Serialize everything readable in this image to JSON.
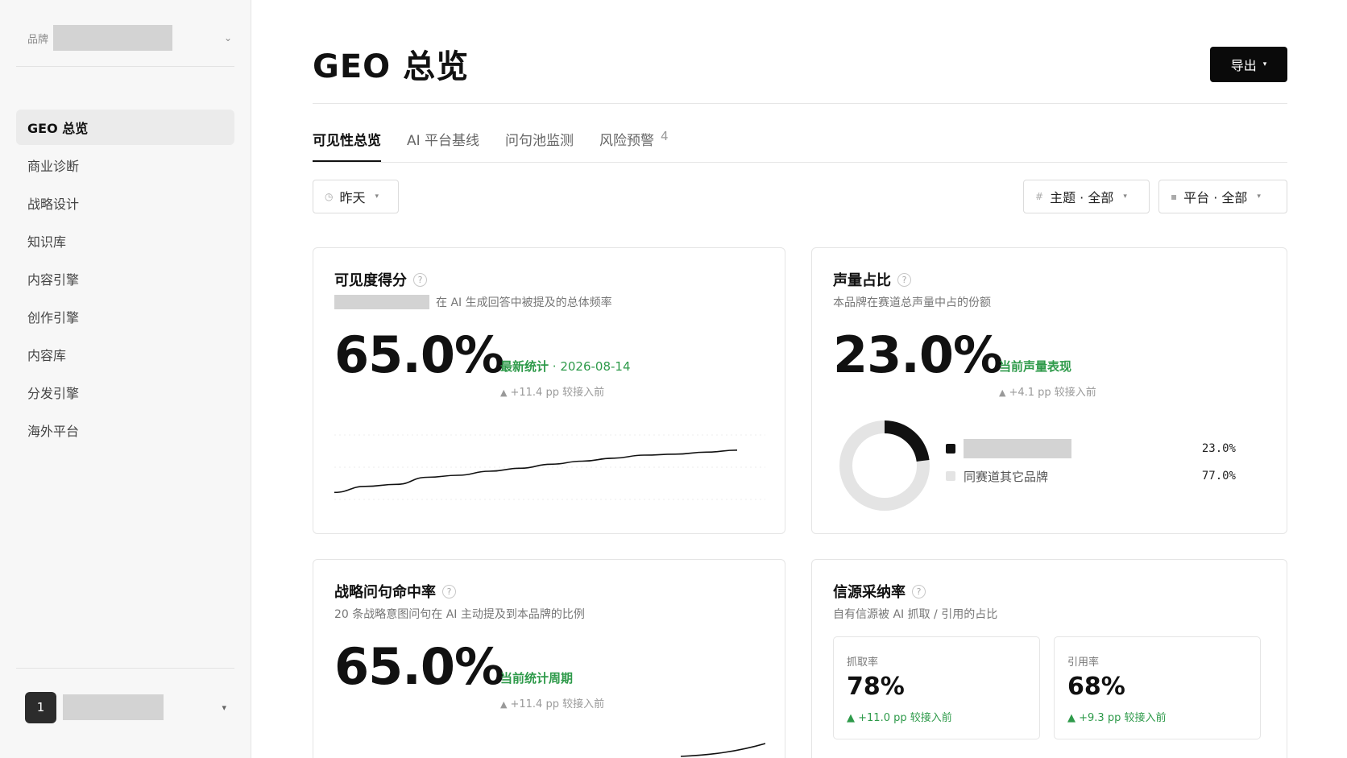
{
  "sidebar": {
    "brand_label": "品牌",
    "brand_caret": "⌄",
    "nav": [
      "GEO 总览",
      "商业诊断",
      "战略设计",
      "知识库",
      "内容引擎",
      "创作引擎",
      "内容库",
      "分发引擎",
      "海外平台"
    ],
    "user": {
      "avatar_text": "1",
      "caret": "▾"
    }
  },
  "header": {
    "title": "GEO 总览",
    "export_label": "导出",
    "export_caret": "▾"
  },
  "tabs": [
    {
      "label": "可见性总览",
      "active": true
    },
    {
      "label": "AI 平台基线"
    },
    {
      "label": "问句池监测"
    },
    {
      "label": "风险预警",
      "count": "4"
    }
  ],
  "filters": {
    "date": {
      "icon": "clock-icon",
      "label": "昨天"
    },
    "topic": {
      "icon": "hash-icon",
      "label": "主题 · 全部"
    },
    "platform": {
      "icon": "square-icon",
      "label": "平台 · 全部"
    },
    "caret": "▾"
  },
  "cards": {
    "visibility": {
      "title": "可见度得分",
      "subtitle": "在 AI 生成回答中被提及的总体频率",
      "value": "65.0%",
      "status": "最新统计",
      "date": " · 2026-08-14",
      "delta": "+11.4 pp 较接入前",
      "trend": [
        65,
        59,
        57,
        50,
        48,
        44,
        41,
        37,
        34,
        31,
        28,
        27,
        25,
        23
      ]
    },
    "share": {
      "title": "声量占比",
      "subtitle": "本品牌在赛道总声量中占的份额",
      "value": "23.0%",
      "status": "当前声量表现",
      "delta": "+4.1 pp 较接入前",
      "legend": [
        {
          "label": "",
          "value": "23.0%",
          "color": "#111111"
        },
        {
          "label": "同赛道其它品牌",
          "value": "77.0%",
          "color": "#e4e4e4"
        }
      ],
      "donut_fraction": 0.23
    },
    "strategy": {
      "title": "战略问句命中率",
      "subtitle": "20 条战略意图问句在 AI 主动提及到本品牌的比例",
      "value": "65.0%",
      "status": "当前统计周期",
      "delta": "+11.4 pp 较接入前"
    },
    "source": {
      "title": "信源采纳率",
      "subtitle": "自有信源被 AI 抓取 / 引用的占比",
      "crawl": {
        "label": "抓取率",
        "value": "78%",
        "delta": "+11.0 pp 较接入前"
      },
      "cite": {
        "label": "引用率",
        "value": "68%",
        "delta": "+9.3 pp 较接入前"
      }
    }
  },
  "icons": {
    "help": "?",
    "triangle_up": "▲"
  },
  "colors": {
    "accent_green": "#2e9a4a",
    "primary": "#0a0a0a"
  }
}
